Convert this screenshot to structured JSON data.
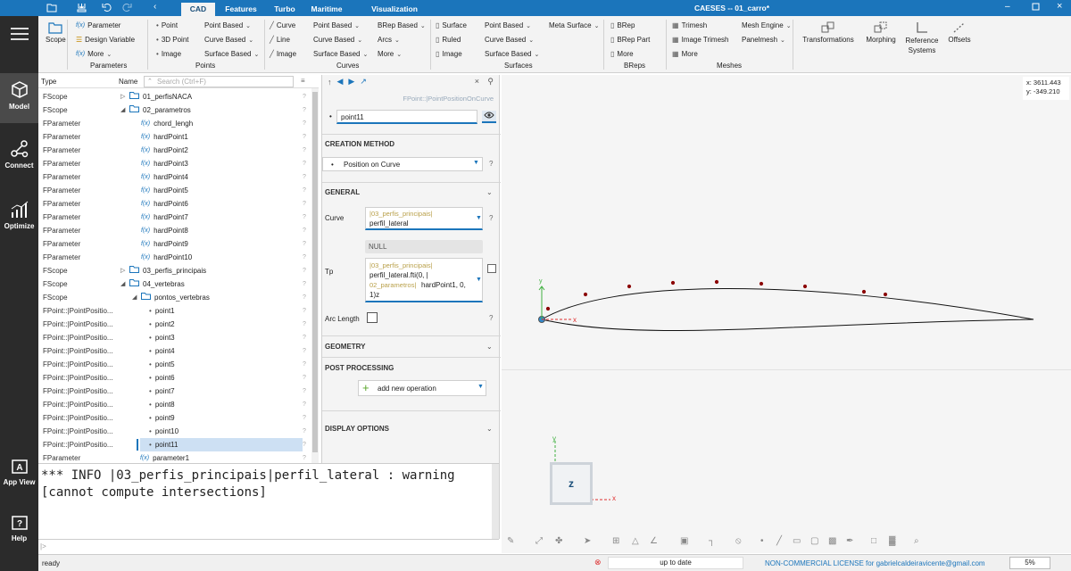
{
  "window": {
    "title": "CAESES -- 01_carro*"
  },
  "tabs": [
    "CAD",
    "Features",
    "Turbo",
    "Maritime",
    "Visualization"
  ],
  "active_tab": "CAD",
  "nav": [
    "Model",
    "Connect",
    "Optimize",
    "App View",
    "Help"
  ],
  "ribbon": {
    "scope": "Scope",
    "parameters": {
      "items": [
        "Parameter",
        "Design Variable",
        "More"
      ],
      "group": "Parameters"
    },
    "points": {
      "col1": [
        "Point",
        "3D Point",
        "Image"
      ],
      "col2": [
        "Point Based",
        "Curve Based",
        "Surface Based"
      ],
      "group": "Points"
    },
    "curves": {
      "col1": [
        "Curve",
        "Line",
        "Image"
      ],
      "col2": [
        "Point Based",
        "Curve Based",
        "Surface Based"
      ],
      "col3": [
        "BRep Based",
        "Arcs",
        "More"
      ],
      "group": "Curves"
    },
    "surfaces": {
      "col1": [
        "Surface",
        "Ruled",
        "Image"
      ],
      "col2": [
        "Point Based",
        "Curve Based",
        "Surface Based"
      ],
      "col3": [
        "Meta Surface"
      ],
      "group": "Surfaces"
    },
    "breps": {
      "items": [
        "BRep",
        "BRep Part",
        "More"
      ],
      "group": "BReps"
    },
    "meshes": {
      "col1": [
        "Trimesh",
        "Image Trimesh",
        "More"
      ],
      "col2": [
        "Mesh Engine",
        "Panelmesh"
      ],
      "group": "Meshes"
    },
    "big": [
      "Transformations",
      "Morphing",
      "Reference Systems",
      "Offsets"
    ]
  },
  "tree": {
    "col_type": "Type",
    "col_name": "Name",
    "search_placeholder": "Search (Ctrl+F)",
    "rows": [
      {
        "type": "FScope",
        "name": "01_perfisNACA",
        "indent": 0,
        "kind": "folder",
        "exp": "closed"
      },
      {
        "type": "FScope",
        "name": "02_parametros",
        "indent": 0,
        "kind": "folder",
        "exp": "open"
      },
      {
        "type": "FParameter",
        "name": "chord_lengh",
        "indent": 1,
        "kind": "fx"
      },
      {
        "type": "FParameter",
        "name": "hardPoint1",
        "indent": 1,
        "kind": "fx"
      },
      {
        "type": "FParameter",
        "name": "hardPoint2",
        "indent": 1,
        "kind": "fx"
      },
      {
        "type": "FParameter",
        "name": "hardPoint3",
        "indent": 1,
        "kind": "fx"
      },
      {
        "type": "FParameter",
        "name": "hardPoint4",
        "indent": 1,
        "kind": "fx"
      },
      {
        "type": "FParameter",
        "name": "hardPoint5",
        "indent": 1,
        "kind": "fx"
      },
      {
        "type": "FParameter",
        "name": "hardPoint6",
        "indent": 1,
        "kind": "fx"
      },
      {
        "type": "FParameter",
        "name": "hardPoint7",
        "indent": 1,
        "kind": "fx"
      },
      {
        "type": "FParameter",
        "name": "hardPoint8",
        "indent": 1,
        "kind": "fx"
      },
      {
        "type": "FParameter",
        "name": "hardPoint9",
        "indent": 1,
        "kind": "fx"
      },
      {
        "type": "FParameter",
        "name": "hardPoint10",
        "indent": 1,
        "kind": "fx"
      },
      {
        "type": "FScope",
        "name": "03_perfis_principais",
        "indent": 0,
        "kind": "folder",
        "exp": "closed"
      },
      {
        "type": "FScope",
        "name": "04_vertebras",
        "indent": 0,
        "kind": "folder",
        "exp": "open"
      },
      {
        "type": "FScope",
        "name": "pontos_vertebras",
        "indent": 1,
        "kind": "folder",
        "exp": "open"
      },
      {
        "type": "FPoint::|PointPositio...",
        "name": "point1",
        "indent": 2,
        "kind": "pt"
      },
      {
        "type": "FPoint::|PointPositio...",
        "name": "point2",
        "indent": 2,
        "kind": "pt"
      },
      {
        "type": "FPoint::|PointPositio...",
        "name": "point3",
        "indent": 2,
        "kind": "pt"
      },
      {
        "type": "FPoint::|PointPositio...",
        "name": "point4",
        "indent": 2,
        "kind": "pt"
      },
      {
        "type": "FPoint::|PointPositio...",
        "name": "point5",
        "indent": 2,
        "kind": "pt"
      },
      {
        "type": "FPoint::|PointPositio...",
        "name": "point6",
        "indent": 2,
        "kind": "pt"
      },
      {
        "type": "FPoint::|PointPositio...",
        "name": "point7",
        "indent": 2,
        "kind": "pt"
      },
      {
        "type": "FPoint::|PointPositio...",
        "name": "point8",
        "indent": 2,
        "kind": "pt"
      },
      {
        "type": "FPoint::|PointPositio...",
        "name": "point9",
        "indent": 2,
        "kind": "pt"
      },
      {
        "type": "FPoint::|PointPositio...",
        "name": "point10",
        "indent": 2,
        "kind": "pt"
      },
      {
        "type": "FPoint::|PointPositio...",
        "name": "point11",
        "indent": 2,
        "kind": "pt",
        "selected": true
      },
      {
        "type": "FParameter",
        "name": "parameter1",
        "indent": -1,
        "kind": "fx"
      }
    ]
  },
  "props": {
    "breadcrumb": "FPoint::|PointPositionOnCurve",
    "name_value": "point11",
    "creation_method_title": "CREATION METHOD",
    "creation_method_value": "Position on Curve",
    "general_title": "GENERAL",
    "curve_label": "Curve",
    "curve_scope": "|03_perfis_principais|",
    "curve_value": "perfil_lateral",
    "null_label": "NULL",
    "tp_label": "Tp",
    "tp_line1_scope": "|03_perfis_principais|",
    "tp_line2": "perfil_lateral.fti(0, |",
    "tp_line3_scope": "02_parametros|",
    "tp_line3_rest": "hardPoint1, 0,",
    "tp_line4": "1)z",
    "arc_length_label": "Arc Length",
    "geometry_title": "GEOMETRY",
    "post_processing_title": "POST PROCESSING",
    "add_operation": "add new operation",
    "display_options_title": "DISPLAY OPTIONS"
  },
  "console": {
    "line1": "*** INFO |03_perfis_principais|perfil_lateral : warning",
    "line2": "[cannot compute intersections]"
  },
  "viewport": {
    "coord_x": "x: 3611.443",
    "coord_y": "y: -349.210",
    "axis_x": "x",
    "axis_y": "y",
    "view_label": "z"
  },
  "status": {
    "left": "ready",
    "mid": "up to date",
    "license": "NON-COMMERCIAL LICENSE for gabrielcaldeiravicente@gmail.com",
    "zoom": "5%"
  },
  "colors": {
    "accent": "#1b75bb",
    "nav_bg": "#2b2b2b",
    "point_marker": "#8b0000",
    "axis_x": "#e03030",
    "axis_y": "#40b040",
    "selection": "#cde0f3"
  }
}
